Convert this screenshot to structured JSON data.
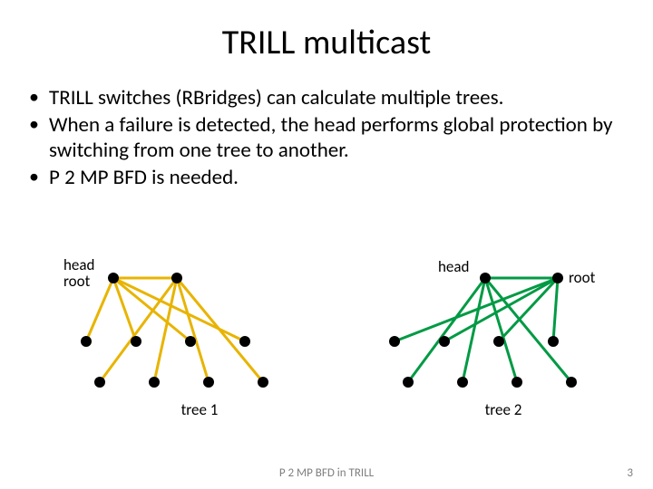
{
  "title": "TRILL multicast",
  "bullets": [
    "TRILL switches (RBridges) can calculate multiple trees.",
    "When a failure is detected, the head performs global protection by switching from one tree to  another.",
    "P 2 MP BFD is needed."
  ],
  "tree1": {
    "head_label": "head",
    "root_label": "root",
    "caption": "tree 1",
    "line_color": "#e8b400"
  },
  "tree2": {
    "head_label": "head",
    "root_label": "root",
    "caption": "tree 2",
    "line_color": "#009a44"
  },
  "footer": "P 2 MP BFD in TRILL",
  "page_number": "3"
}
